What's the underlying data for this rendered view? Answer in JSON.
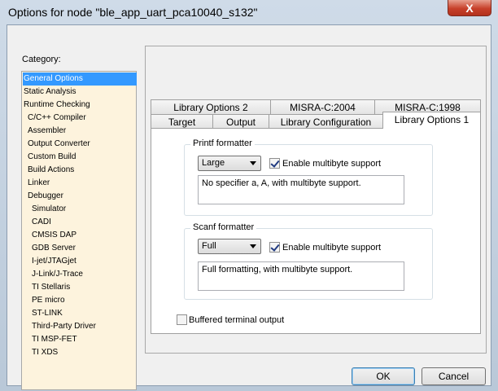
{
  "window": {
    "title": "Options for node \"ble_app_uart_pca10040_s132\"",
    "close_glyph": "X"
  },
  "category": {
    "label": "Category:",
    "items": [
      "General Options",
      "Static Analysis",
      "Runtime Checking",
      "C/C++ Compiler",
      "Assembler",
      "Output Converter",
      "Custom Build",
      "Build Actions",
      "Linker",
      "Debugger",
      "Simulator",
      "CADI",
      "CMSIS DAP",
      "GDB Server",
      "I-jet/JTAGjet",
      "J-Link/J-Trace",
      "TI Stellaris",
      "PE micro",
      "ST-LINK",
      "Third-Party Driver",
      "TI MSP-FET",
      "TI XDS"
    ],
    "selected": "General Options"
  },
  "tabs": {
    "row1": [
      "Library Options 2",
      "MISRA-C:2004",
      "MISRA-C:1998"
    ],
    "row2": [
      "Target",
      "Output",
      "Library Configuration",
      "Library Options 1"
    ],
    "active": "Library Options 1"
  },
  "printf": {
    "legend": "Printf formatter",
    "selected": "Large",
    "checkbox_label": "Enable multibyte support",
    "checked": true,
    "description": "No specifier a, A, with multibyte support."
  },
  "scanf": {
    "legend": "Scanf formatter",
    "selected": "Full",
    "checkbox_label": "Enable multibyte support",
    "checked": true,
    "description": "Full formatting, with multibyte support."
  },
  "buffered": {
    "label": "Buffered terminal output",
    "checked": false
  },
  "buttons": {
    "ok": "OK",
    "cancel": "Cancel"
  },
  "colors": {
    "selection": "#3399ff",
    "category_bg": "#fdf3dd"
  }
}
